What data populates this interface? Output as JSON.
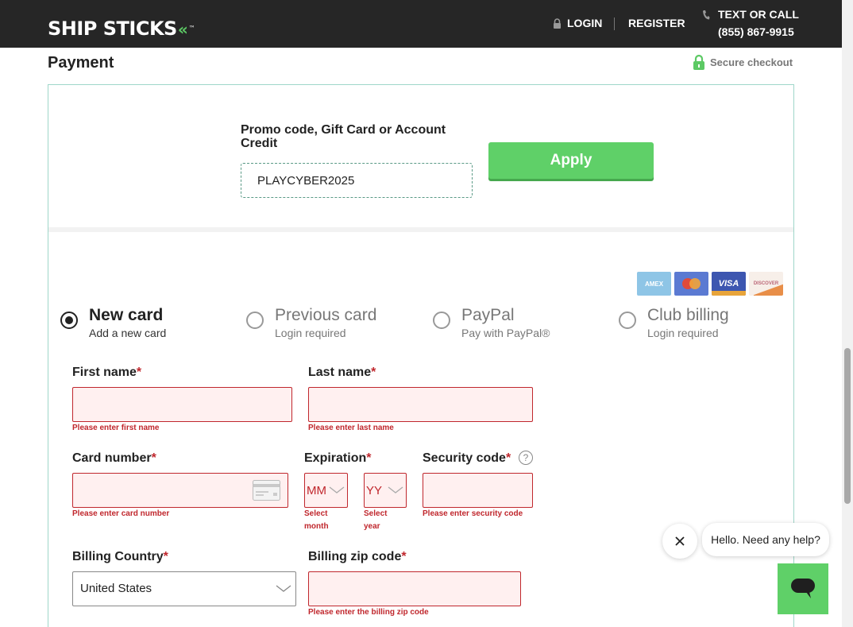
{
  "header": {
    "brand": "SHIP STICKS",
    "brand_chevrons": "«",
    "brand_tm": "™",
    "login": "LOGIN",
    "register": "REGISTER",
    "contact_label": "TEXT OR CALL",
    "contact_phone": "(855) 867-9915"
  },
  "page": {
    "title": "Payment",
    "secure": "Secure checkout"
  },
  "promo": {
    "label": "Promo code, Gift Card or Account Credit",
    "value": "PLAYCYBER2025",
    "apply": "Apply"
  },
  "card_brands": [
    {
      "name": "AMEX",
      "icon": "amex-icon"
    },
    {
      "name": "",
      "icon": "mastercard-icon"
    },
    {
      "name": "VISA",
      "icon": "visa-icon"
    },
    {
      "name": "DISCOVER",
      "icon": "discover-icon"
    }
  ],
  "payment_options": [
    {
      "title": "New card",
      "sub": "Add a new card",
      "selected": true
    },
    {
      "title": "Previous card",
      "sub": "Login required",
      "selected": false
    },
    {
      "title": "PayPal",
      "sub": "Pay with PayPal®",
      "selected": false
    },
    {
      "title": "Club billing",
      "sub": "Login required",
      "selected": false
    }
  ],
  "form": {
    "required_mark": "*",
    "first_name": {
      "label": "First name",
      "error": "Please enter first name"
    },
    "last_name": {
      "label": "Last name",
      "error": "Please enter last name"
    },
    "card_number": {
      "label": "Card number",
      "error": "Please enter card number"
    },
    "expiration": {
      "label": "Expiration",
      "month": "MM",
      "year": "YY",
      "month_error_1": "Select",
      "month_error_2": "month",
      "year_error_1": "Select",
      "year_error_2": "year"
    },
    "security_code": {
      "label": "Security code",
      "error": "Please enter security code",
      "help": "?"
    },
    "billing_country": {
      "label": "Billing Country",
      "value": "United States"
    },
    "billing_zip": {
      "label": "Billing zip code",
      "error": "Please enter the billing zip code"
    }
  },
  "chat": {
    "message": "Hello. Need any help?"
  },
  "colors": {
    "header_bg": "#262626",
    "accent_green": "#5fd068",
    "error_red": "#c0272d",
    "error_bg": "#fff0f0"
  }
}
